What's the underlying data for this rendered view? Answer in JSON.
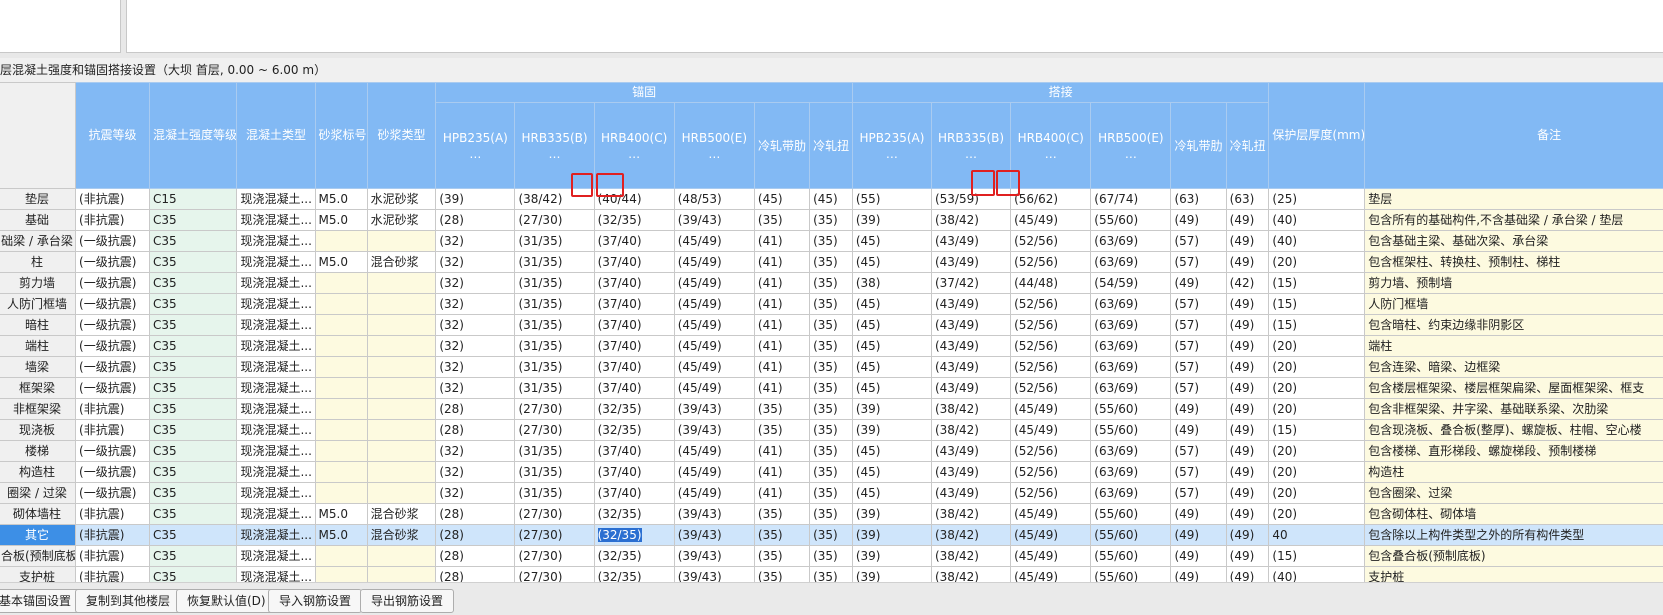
{
  "caption": "层混凝土强度和锚固搭接设置（大坝  首层, 0.00 ~ 6.00 m）",
  "groups": {
    "anchor": "锚固",
    "lap": "搭接"
  },
  "headers": {
    "seismic": "抗震等级",
    "concrete_grade": "混凝土强度等级",
    "concrete_type": "混凝土类型",
    "mortar_grade": "砂浆标号",
    "mortar_type": "砂浆类型",
    "a_hpb235": "HPB235(A)…",
    "a_hrb335": "HRB335(B)…",
    "a_hrb400": "HRB400(C)…",
    "a_hrb500": "HRB500(E)…",
    "a_cold_ribbed": "冷轧带肋",
    "a_cold_twist": "冷轧扭",
    "l_hpb235": "HPB235(A)…",
    "l_hrb335": "HRB335(B)…",
    "l_hrb400": "HRB400(C)…",
    "l_hrb500": "HRB500(E)…",
    "l_cold_ribbed": "冷轧带肋",
    "l_cold_twist": "冷轧扭",
    "cover": "保护层厚度(mm)",
    "remark": "备注"
  },
  "rows": [
    {
      "name": "垫层",
      "c": [
        "(非抗震)",
        "C15",
        "现浇混凝土...",
        "M5.0",
        "水泥砂浆",
        "(39)",
        "(38/42)",
        "(40/44)",
        "(48/53)",
        "(45)",
        "(45)",
        "(55)",
        "(53/59)",
        "(56/62)",
        "(67/74)",
        "(63)",
        "(63)",
        "(25)",
        "垫层"
      ]
    },
    {
      "name": "基础",
      "c": [
        "(非抗震)",
        "C35",
        "现浇混凝土...",
        "M5.0",
        "水泥砂浆",
        "(28)",
        "(27/30)",
        "(32/35)",
        "(39/43)",
        "(35)",
        "(35)",
        "(39)",
        "(38/42)",
        "(45/49)",
        "(55/60)",
        "(49)",
        "(49)",
        "(40)",
        "包含所有的基础构件,不含基础梁 / 承台梁 / 垫层"
      ]
    },
    {
      "name": "础梁 / 承台梁",
      "c": [
        "(一级抗震)",
        "C35",
        "现浇混凝土...",
        "",
        "",
        "(32)",
        "(31/35)",
        "(37/40)",
        "(45/49)",
        "(41)",
        "(35)",
        "(45)",
        "(43/49)",
        "(52/56)",
        "(63/69)",
        "(57)",
        "(49)",
        "(40)",
        "包含基础主梁、基础次梁、承台梁"
      ]
    },
    {
      "name": "柱",
      "c": [
        "(一级抗震)",
        "C35",
        "现浇混凝土...",
        "M5.0",
        "混合砂浆",
        "(32)",
        "(31/35)",
        "(37/40)",
        "(45/49)",
        "(41)",
        "(35)",
        "(45)",
        "(43/49)",
        "(52/56)",
        "(63/69)",
        "(57)",
        "(49)",
        "(20)",
        "包含框架柱、转换柱、预制柱、梯柱"
      ]
    },
    {
      "name": "剪力墙",
      "c": [
        "(一级抗震)",
        "C35",
        "现浇混凝土...",
        "",
        "",
        "(32)",
        "(31/35)",
        "(37/40)",
        "(45/49)",
        "(41)",
        "(35)",
        "(38)",
        "(37/42)",
        "(44/48)",
        "(54/59)",
        "(49)",
        "(42)",
        "(15)",
        "剪力墙、预制墙"
      ]
    },
    {
      "name": "人防门框墙",
      "c": [
        "(一级抗震)",
        "C35",
        "现浇混凝土...",
        "",
        "",
        "(32)",
        "(31/35)",
        "(37/40)",
        "(45/49)",
        "(41)",
        "(35)",
        "(45)",
        "(43/49)",
        "(52/56)",
        "(63/69)",
        "(57)",
        "(49)",
        "(15)",
        "人防门框墙"
      ]
    },
    {
      "name": "暗柱",
      "c": [
        "(一级抗震)",
        "C35",
        "现浇混凝土...",
        "",
        "",
        "(32)",
        "(31/35)",
        "(37/40)",
        "(45/49)",
        "(41)",
        "(35)",
        "(45)",
        "(43/49)",
        "(52/56)",
        "(63/69)",
        "(57)",
        "(49)",
        "(15)",
        "包含暗柱、约束边缘非阴影区"
      ]
    },
    {
      "name": "端柱",
      "c": [
        "(一级抗震)",
        "C35",
        "现浇混凝土...",
        "",
        "",
        "(32)",
        "(31/35)",
        "(37/40)",
        "(45/49)",
        "(41)",
        "(35)",
        "(45)",
        "(43/49)",
        "(52/56)",
        "(63/69)",
        "(57)",
        "(49)",
        "(20)",
        "端柱"
      ]
    },
    {
      "name": "墙梁",
      "c": [
        "(一级抗震)",
        "C35",
        "现浇混凝土...",
        "",
        "",
        "(32)",
        "(31/35)",
        "(37/40)",
        "(45/49)",
        "(41)",
        "(35)",
        "(45)",
        "(43/49)",
        "(52/56)",
        "(63/69)",
        "(57)",
        "(49)",
        "(20)",
        "包含连梁、暗梁、边框梁"
      ]
    },
    {
      "name": "框架梁",
      "c": [
        "(一级抗震)",
        "C35",
        "现浇混凝土...",
        "",
        "",
        "(32)",
        "(31/35)",
        "(37/40)",
        "(45/49)",
        "(41)",
        "(35)",
        "(45)",
        "(43/49)",
        "(52/56)",
        "(63/69)",
        "(57)",
        "(49)",
        "(20)",
        "包含楼层框架梁、楼层框架扁梁、屋面框架梁、框支"
      ]
    },
    {
      "name": "非框架梁",
      "c": [
        "(非抗震)",
        "C35",
        "现浇混凝土...",
        "",
        "",
        "(28)",
        "(27/30)",
        "(32/35)",
        "(39/43)",
        "(35)",
        "(35)",
        "(39)",
        "(38/42)",
        "(45/49)",
        "(55/60)",
        "(49)",
        "(49)",
        "(20)",
        "包含非框架梁、井字梁、基础联系梁、次肋梁"
      ]
    },
    {
      "name": "现浇板",
      "c": [
        "(非抗震)",
        "C35",
        "现浇混凝土...",
        "",
        "",
        "(28)",
        "(27/30)",
        "(32/35)",
        "(39/43)",
        "(35)",
        "(35)",
        "(39)",
        "(38/42)",
        "(45/49)",
        "(55/60)",
        "(49)",
        "(49)",
        "(15)",
        "包含现浇板、叠合板(整厚)、螺旋板、柱帽、空心楼"
      ]
    },
    {
      "name": "楼梯",
      "c": [
        "(一级抗震)",
        "C35",
        "现浇混凝土...",
        "",
        "",
        "(32)",
        "(31/35)",
        "(37/40)",
        "(45/49)",
        "(41)",
        "(35)",
        "(45)",
        "(43/49)",
        "(52/56)",
        "(63/69)",
        "(57)",
        "(49)",
        "(20)",
        "包含楼梯、直形梯段、螺旋梯段、预制楼梯"
      ]
    },
    {
      "name": "构造柱",
      "c": [
        "(一级抗震)",
        "C35",
        "现浇混凝土...",
        "",
        "",
        "(32)",
        "(31/35)",
        "(37/40)",
        "(45/49)",
        "(41)",
        "(35)",
        "(45)",
        "(43/49)",
        "(52/56)",
        "(63/69)",
        "(57)",
        "(49)",
        "(20)",
        "构造柱"
      ]
    },
    {
      "name": "圈梁 / 过梁",
      "c": [
        "(一级抗震)",
        "C35",
        "现浇混凝土...",
        "",
        "",
        "(32)",
        "(31/35)",
        "(37/40)",
        "(45/49)",
        "(41)",
        "(35)",
        "(45)",
        "(43/49)",
        "(52/56)",
        "(63/69)",
        "(57)",
        "(49)",
        "(20)",
        "包含圈梁、过梁"
      ]
    },
    {
      "name": "砌体墙柱",
      "c": [
        "(非抗震)",
        "C35",
        "现浇混凝土...",
        "M5.0",
        "混合砂浆",
        "(28)",
        "(27/30)",
        "(32/35)",
        "(39/43)",
        "(35)",
        "(35)",
        "(39)",
        "(38/42)",
        "(45/49)",
        "(55/60)",
        "(49)",
        "(49)",
        "(20)",
        "包含砌体柱、砌体墙"
      ]
    },
    {
      "name": "其它",
      "c": [
        "(非抗震)",
        "C35",
        "现浇混凝土...",
        "M5.0",
        "混合砂浆",
        "(28)",
        "(27/30)",
        "(32/35)",
        "(39/43)",
        "(35)",
        "(35)",
        "(39)",
        "(38/42)",
        "(45/49)",
        "(55/60)",
        "(49)",
        "(49)",
        "40",
        "包含除以上构件类型之外的所有构件类型"
      ]
    },
    {
      "name": "合板(预制底板)",
      "c": [
        "(非抗震)",
        "C35",
        "现浇混凝土...",
        "",
        "",
        "(28)",
        "(27/30)",
        "(32/35)",
        "(39/43)",
        "(35)",
        "(35)",
        "(39)",
        "(38/42)",
        "(45/49)",
        "(55/60)",
        "(49)",
        "(49)",
        "(15)",
        "包含叠合板(预制底板)"
      ]
    },
    {
      "name": "支护桩",
      "c": [
        "(非抗震)",
        "C35",
        "现浇混凝土...",
        "",
        "",
        "(28)",
        "(27/30)",
        "(32/35)",
        "(39/43)",
        "(35)",
        "(35)",
        "(39)",
        "(38/42)",
        "(45/49)",
        "(55/60)",
        "(49)",
        "(49)",
        "(40)",
        "支护桩"
      ]
    }
  ],
  "buttons": {
    "basic_anchor": "基本锚固设置",
    "copy_floors": "复制到其他楼层",
    "restore_default": "恢复默认值(D)",
    "import_rebar": "导入钢筋设置",
    "export_rebar": "导出钢筋设置"
  }
}
